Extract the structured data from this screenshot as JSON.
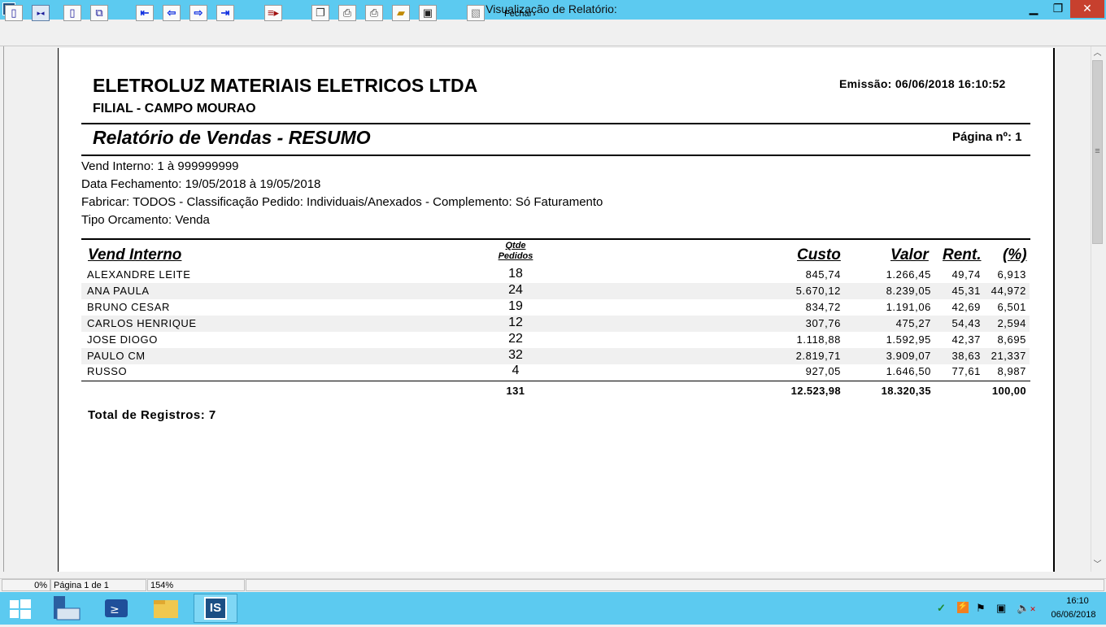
{
  "window": {
    "title": "Visualização de Relatório:",
    "app_icon": "IS"
  },
  "toolbar": {
    "close_label": "Fechar"
  },
  "report": {
    "company": "ELETROLUZ MATERIAIS ELETRICOS LTDA",
    "branch": "FILIAL - CAMPO MOURAO",
    "emissao": "Emissão: 06/06/2018 16:10:52",
    "title": "Relatório de Vendas - RESUMO",
    "pagina": "Página nº: 1",
    "filters": [
      "Vend Interno: 1 à 999999999",
      "Data Fechamento: 19/05/2018 à 19/05/2018",
      "Fabricar: TODOS - Classificação Pedido: Individuais/Anexados - Complemento: Só Faturamento",
      "Tipo Orcamento: Venda"
    ],
    "columns": {
      "vend": "Vend Interno",
      "qtde_1": "Qtde",
      "qtde_2": "Pedidos",
      "custo": "Custo",
      "valor": "Valor",
      "rent": "Rent.",
      "pct": "(%)"
    },
    "rows": [
      {
        "name": "ALEXANDRE LEITE",
        "qtde": "18",
        "custo": "845,74",
        "valor": "1.266,45",
        "rent": "49,74",
        "pct": "6,913"
      },
      {
        "name": "ANA PAULA",
        "qtde": "24",
        "custo": "5.670,12",
        "valor": "8.239,05",
        "rent": "45,31",
        "pct": "44,972"
      },
      {
        "name": "BRUNO CESAR",
        "qtde": "19",
        "custo": "834,72",
        "valor": "1.191,06",
        "rent": "42,69",
        "pct": "6,501"
      },
      {
        "name": "CARLOS HENRIQUE",
        "qtde": "12",
        "custo": "307,76",
        "valor": "475,27",
        "rent": "54,43",
        "pct": "2,594"
      },
      {
        "name": "JOSE DIOGO",
        "qtde": "22",
        "custo": "1.118,88",
        "valor": "1.592,95",
        "rent": "42,37",
        "pct": "8,695"
      },
      {
        "name": "PAULO CM",
        "qtde": "32",
        "custo": "2.819,71",
        "valor": "3.909,07",
        "rent": "38,63",
        "pct": "21,337"
      },
      {
        "name": "RUSSO",
        "qtde": "4",
        "custo": "927,05",
        "valor": "1.646,50",
        "rent": "77,61",
        "pct": "8,987"
      }
    ],
    "totals": {
      "qtde": "131",
      "custo": "12.523,98",
      "valor": "18.320,35",
      "pct": "100,00"
    },
    "total_registros": "Total de Registros: 7"
  },
  "status": {
    "progress": "0%",
    "page": "Página 1 de 1",
    "zoom": "154%"
  },
  "taskbar": {
    "time": "16:10",
    "date": "06/06/2018",
    "active_app": "IS"
  }
}
